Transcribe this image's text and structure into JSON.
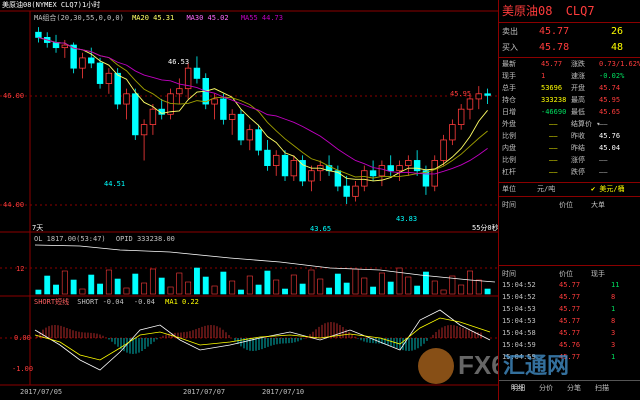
{
  "window": {
    "title": "美原油08(NYMEX CLQ7)1小时"
  },
  "main_legend": {
    "label": "MA组合(20,30,55,0,0,0)",
    "ma20": "MA20 45.31",
    "ma30": "MA30 45.02",
    "ma55": "MA55 44.73"
  },
  "price_axis": [
    "46.00",
    "44.00"
  ],
  "annotations": {
    "high": "46.53",
    "low1": "44.51",
    "low2": "43.65",
    "low3": "43.83",
    "last_high": "45.95"
  },
  "chart_footer": {
    "left": "7天",
    "right": "55分0秒"
  },
  "volume_legend": {
    "ol": "OL 1817.00(53:47)",
    "opid": "OPID   333238.00"
  },
  "volume_axis": "12",
  "short_legend": {
    "name": "SHORT短线",
    "short": "SHORT  -0.04",
    "v2": "-0.04",
    "ma1": "MA1  0.22"
  },
  "short_axis": [
    "0.00",
    "-1.00"
  ],
  "date_axis": [
    "2017/07/05",
    "2017/07/07",
    "2017/07/10"
  ],
  "watermark": {
    "text1": "FX6",
    "text2": "汇通网"
  },
  "colors": {
    "up": "#ff3c3c",
    "down": "#00ffff",
    "ma20": "#ffff66",
    "ma30": "#a0a000",
    "ma55": "#c000c0",
    "frame": "#8b0000"
  },
  "chart_data": {
    "type": "candlestick",
    "xlabel": "",
    "ylabel": "",
    "ylim": [
      43.3,
      47.2
    ],
    "candles": [
      [
        47.0,
        47.1,
        46.8,
        46.9
      ],
      [
        46.9,
        47.0,
        46.7,
        46.8
      ],
      [
        46.8,
        46.95,
        46.6,
        46.7
      ],
      [
        46.7,
        46.85,
        46.5,
        46.75
      ],
      [
        46.75,
        46.8,
        46.2,
        46.3
      ],
      [
        46.3,
        46.6,
        46.1,
        46.5
      ],
      [
        46.5,
        46.7,
        46.3,
        46.4
      ],
      [
        46.4,
        46.5,
        45.9,
        46.0
      ],
      [
        46.0,
        46.3,
        45.8,
        46.2
      ],
      [
        46.2,
        46.3,
        45.5,
        45.6
      ],
      [
        45.6,
        45.9,
        45.3,
        45.8
      ],
      [
        45.8,
        45.9,
        44.9,
        45.0
      ],
      [
        45.0,
        45.3,
        44.5,
        45.2
      ],
      [
        45.2,
        45.6,
        45.0,
        45.5
      ],
      [
        45.5,
        45.7,
        45.3,
        45.4
      ],
      [
        45.4,
        45.9,
        45.3,
        45.8
      ],
      [
        45.8,
        46.1,
        45.6,
        45.9
      ],
      [
        45.9,
        46.4,
        45.7,
        46.3
      ],
      [
        46.3,
        46.53,
        46.0,
        46.1
      ],
      [
        46.1,
        46.2,
        45.5,
        45.6
      ],
      [
        45.6,
        45.8,
        45.3,
        45.7
      ],
      [
        45.7,
        45.8,
        45.2,
        45.3
      ],
      [
        45.3,
        45.5,
        45.0,
        45.4
      ],
      [
        45.4,
        45.5,
        44.8,
        44.9
      ],
      [
        44.9,
        45.2,
        44.7,
        45.1
      ],
      [
        45.1,
        45.2,
        44.6,
        44.7
      ],
      [
        44.7,
        44.9,
        44.3,
        44.4
      ],
      [
        44.4,
        44.7,
        44.2,
        44.6
      ],
      [
        44.6,
        44.7,
        44.1,
        44.2
      ],
      [
        44.2,
        44.6,
        44.1,
        44.5
      ],
      [
        44.5,
        44.6,
        44.0,
        44.1
      ],
      [
        44.1,
        44.4,
        43.9,
        44.3
      ],
      [
        44.3,
        44.5,
        44.1,
        44.4
      ],
      [
        44.4,
        44.6,
        44.2,
        44.3
      ],
      [
        44.3,
        44.4,
        43.9,
        44.0
      ],
      [
        44.0,
        44.2,
        43.65,
        43.8
      ],
      [
        43.8,
        44.1,
        43.7,
        44.0
      ],
      [
        44.0,
        44.4,
        43.9,
        44.3
      ],
      [
        44.3,
        44.5,
        44.1,
        44.2
      ],
      [
        44.2,
        44.5,
        44.0,
        44.4
      ],
      [
        44.4,
        44.6,
        44.2,
        44.3
      ],
      [
        44.3,
        44.5,
        44.1,
        44.4
      ],
      [
        44.4,
        44.6,
        44.2,
        44.5
      ],
      [
        44.5,
        44.7,
        44.2,
        44.3
      ],
      [
        44.3,
        44.4,
        43.83,
        44.0
      ],
      [
        44.0,
        44.6,
        43.9,
        44.5
      ],
      [
        44.5,
        45.0,
        44.4,
        44.9
      ],
      [
        44.9,
        45.3,
        44.8,
        45.2
      ],
      [
        45.2,
        45.6,
        45.1,
        45.5
      ],
      [
        45.5,
        45.8,
        45.3,
        45.7
      ],
      [
        45.7,
        45.95,
        45.5,
        45.8
      ],
      [
        45.8,
        45.9,
        45.6,
        45.77
      ]
    ]
  },
  "quote": {
    "name": "美原油08",
    "code": "CLQ7",
    "sell_label": "卖出",
    "sell_price": "45.77",
    "sell_vol": "26",
    "buy_label": "买入",
    "buy_price": "45.78",
    "buy_vol": "48",
    "rows": [
      {
        "l1": "最新",
        "v1": "45.77",
        "l2": "涨跌",
        "v2": "0.73/1.62%"
      },
      {
        "l1": "现手",
        "v1": "1",
        "l2": "速涨",
        "v2": "-0.02%"
      },
      {
        "l1": "总手",
        "v1": "53696",
        "l2": "开盘",
        "v2": "45.74"
      },
      {
        "l1": "持仓",
        "v1": "333238",
        "l2": "最高",
        "v2": "45.95"
      },
      {
        "l1": "日增",
        "v1": "-46690",
        "l2": "最低",
        "v2": "45.65"
      },
      {
        "l1": "外盘",
        "v1": "——",
        "l2": "结算价 ▾",
        "v2": "——"
      },
      {
        "l1": "比例",
        "v1": "——",
        "l2": "昨收",
        "v2": "45.76"
      },
      {
        "l1": "内盘",
        "v1": "——",
        "l2": "昨结",
        "v2": "45.04"
      },
      {
        "l1": "比例",
        "v1": "——",
        "l2": "涨停",
        "v2": "——"
      },
      {
        "l1": "杠杆",
        "v1": "——",
        "l2": "跌停",
        "v2": "——"
      }
    ],
    "unit_label": "单位",
    "unit_value": "元/吨",
    "currency": "✔ 美元/桶",
    "big_header": [
      "时间",
      "价位",
      "大单"
    ],
    "tick_header": [
      "时间",
      "价位",
      "现手"
    ],
    "ticks": [
      {
        "time": "15:04:52",
        "price": "45.77",
        "vol": "11"
      },
      {
        "time": "15:04:52",
        "price": "45.77",
        "vol": "8"
      },
      {
        "time": "15:04:53",
        "price": "45.77",
        "vol": "1"
      },
      {
        "time": "15:04:53",
        "price": "45.77",
        "vol": "8"
      },
      {
        "time": "15:04:58",
        "price": "45.77",
        "vol": "3"
      },
      {
        "time": "15:04:59",
        "price": "45.76",
        "vol": "3"
      },
      {
        "time": "15:04:59",
        "price": "45.77",
        "vol": "1"
      }
    ],
    "tabs": [
      "明细",
      "分价",
      "分笔",
      "扫描"
    ]
  }
}
